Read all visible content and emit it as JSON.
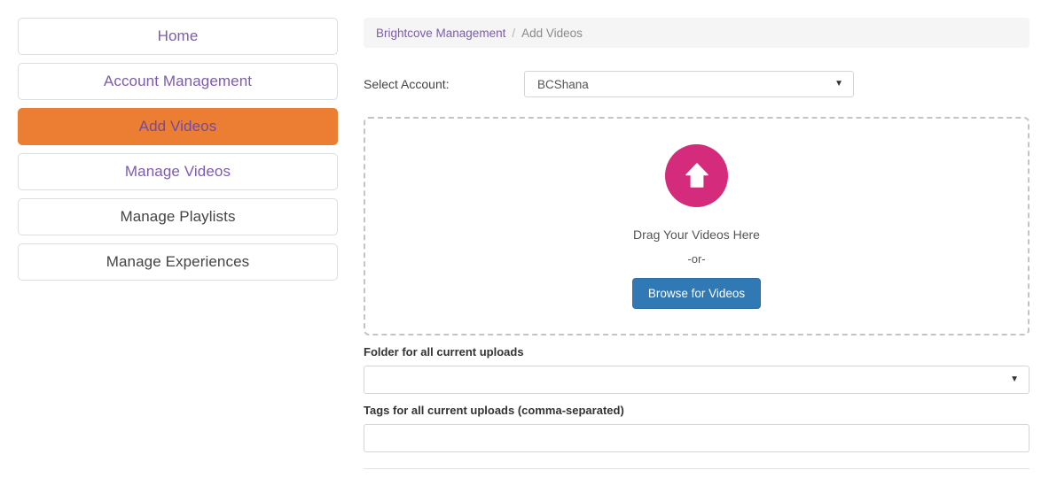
{
  "sidebar": {
    "items": [
      {
        "label": "Home",
        "state": "link"
      },
      {
        "label": "Account Management",
        "state": "link"
      },
      {
        "label": "Add Videos",
        "state": "active"
      },
      {
        "label": "Manage Videos",
        "state": "link"
      },
      {
        "label": "Manage Playlists",
        "state": "plain"
      },
      {
        "label": "Manage Experiences",
        "state": "plain"
      }
    ]
  },
  "breadcrumb": {
    "root": "Brightcove Management",
    "separator": "/",
    "current": "Add Videos"
  },
  "account": {
    "label": "Select Account:",
    "selected": "BCShana",
    "caret": "▼"
  },
  "dropzone": {
    "icon": "upload-arrow-icon",
    "drag_text": "Drag Your Videos Here",
    "or_text": "-or-",
    "browse_label": "Browse for Videos"
  },
  "folder": {
    "label": "Folder for all current uploads",
    "selected": "",
    "caret": "▼"
  },
  "tags": {
    "label": "Tags for all current uploads (comma-separated)",
    "value": "",
    "placeholder": ""
  },
  "colors": {
    "active_orange": "#ec7e33",
    "link_purple": "#7d5bb0",
    "upload_magenta": "#d42b7c",
    "browse_blue": "#3179b5",
    "breadcrumb_bg": "#f5f5f5"
  }
}
